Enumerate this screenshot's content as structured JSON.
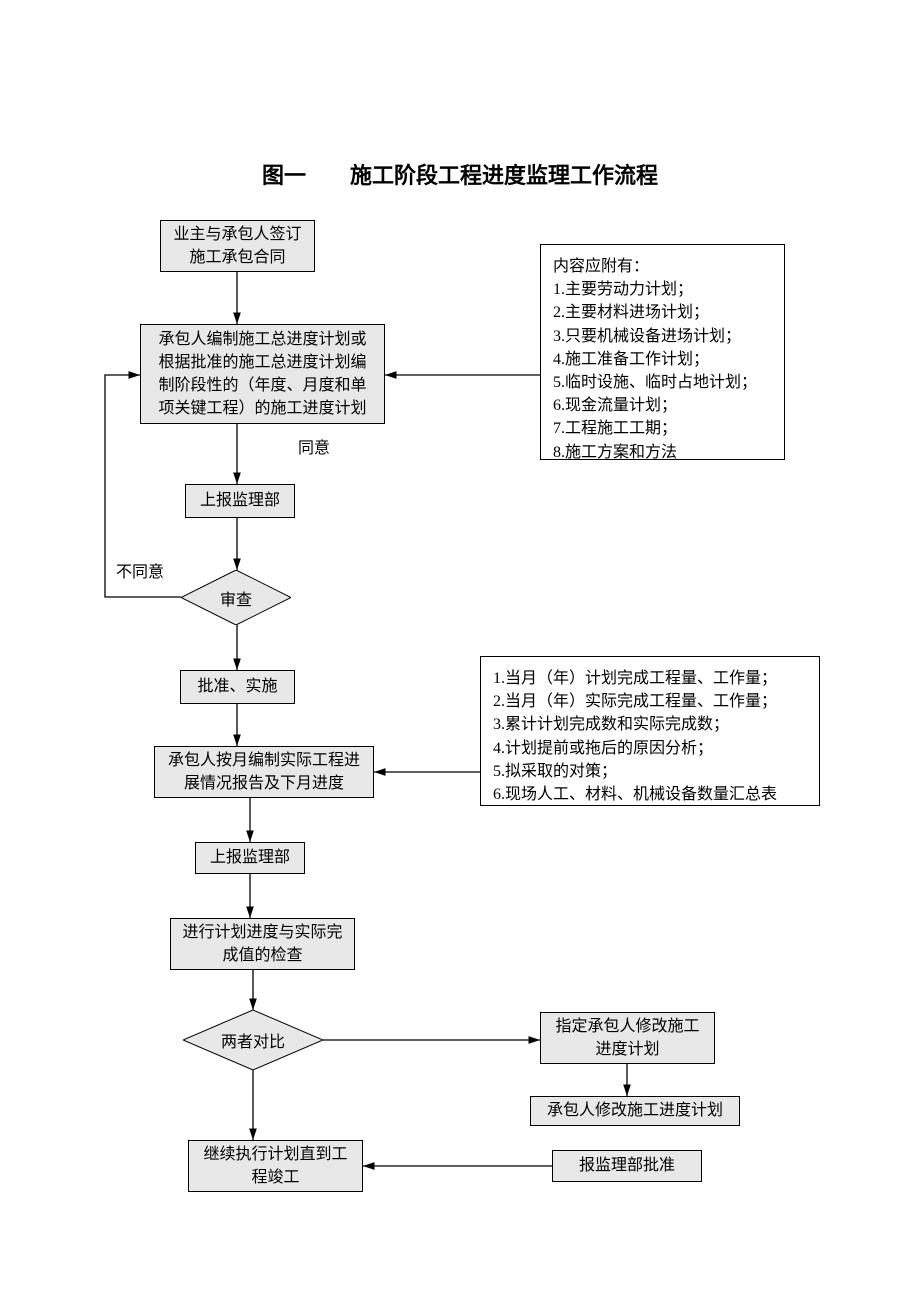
{
  "title": "图一　　施工阶段工程进度监理工作流程",
  "nodes": {
    "n1": "业主与承包人签订施工承包合同",
    "n2": "承包人编制施工总进度计划或根据批准的施工总进度计划编制阶段性的（年度、月度和单项关键工程）的施工进度计划",
    "n3": "上报监理部",
    "d1": "审查",
    "n4": "批准、实施",
    "n5": "承包人按月编制实际工程进展情况报告及下月进度",
    "n6": "上报监理部",
    "n7": "进行计划进度与实际完成值的检查",
    "d2": "两者对比",
    "n8": "继续执行计划直到工程竣工",
    "n9": "指定承包人修改施工进度计划",
    "n10": "承包人修改施工进度计划",
    "n11": "报监理部批准"
  },
  "labels": {
    "agree": "同意",
    "disagree": "不同意"
  },
  "side1": "内容应附有：\n1.主要劳动力计划；\n2.主要材料进场计划；\n3.只要机械设备进场计划；\n4.施工准备工作计划；\n5.临时设施、临时占地计划；\n6.现金流量计划；\n7.工程施工工期；\n8.施工方案和方法",
  "side2": "1.当月（年）计划完成工程量、工作量；\n2.当月（年）实际完成工程量、工作量；\n3.累计计划完成数和实际完成数；\n4.计划提前或拖后的原因分析；\n5.拟采取的对策；\n6.现场人工、材料、机械设备数量汇总表"
}
